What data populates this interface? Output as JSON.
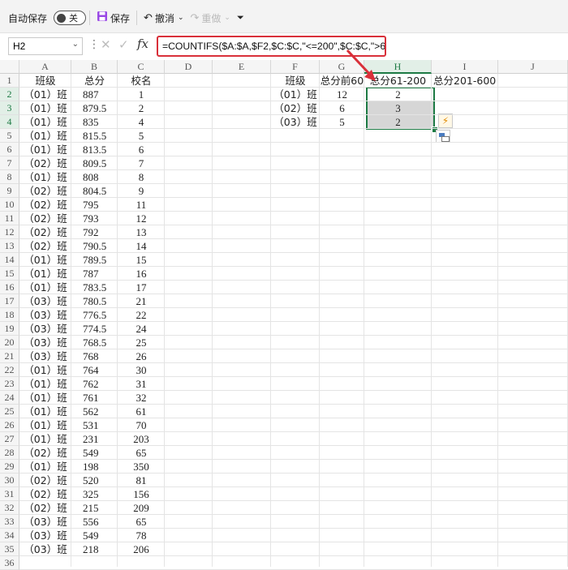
{
  "toolbar": {
    "autosave_label": "自动保存",
    "autosave_state": "关",
    "save_label": "保存",
    "undo_label": "撤消",
    "redo_label": "重做"
  },
  "formula_bar": {
    "name_box": "H2",
    "fx_label": "fx",
    "formula": "=COUNTIFS($A:$A,$F2,$C:$C,\"<=200\",$C:$C,\">60\")"
  },
  "columns": [
    "A",
    "B",
    "C",
    "D",
    "E",
    "F",
    "G",
    "H",
    "I",
    "J"
  ],
  "selected_column": "H",
  "rows": [
    "1",
    "2",
    "3",
    "4",
    "5",
    "6",
    "7",
    "8",
    "9",
    "10",
    "11",
    "12",
    "13",
    "14",
    "15",
    "16",
    "17",
    "18",
    "19",
    "20",
    "21",
    "22",
    "23",
    "24",
    "25",
    "26",
    "27",
    "28",
    "29",
    "30",
    "31",
    "32",
    "33",
    "34",
    "35",
    "36"
  ],
  "data_table": {
    "headers": [
      "班级",
      "总分",
      "校名"
    ],
    "rows": [
      [
        "（01）班",
        "887",
        "1"
      ],
      [
        "（01）班",
        "879.5",
        "2"
      ],
      [
        "（01）班",
        "835",
        "4"
      ],
      [
        "（01）班",
        "815.5",
        "5"
      ],
      [
        "（01）班",
        "813.5",
        "6"
      ],
      [
        "（02）班",
        "809.5",
        "7"
      ],
      [
        "（01）班",
        "808",
        "8"
      ],
      [
        "（02）班",
        "804.5",
        "9"
      ],
      [
        "（02）班",
        "795",
        "11"
      ],
      [
        "（02）班",
        "793",
        "12"
      ],
      [
        "（02）班",
        "792",
        "13"
      ],
      [
        "（02）班",
        "790.5",
        "14"
      ],
      [
        "（01）班",
        "789.5",
        "15"
      ],
      [
        "（01）班",
        "787",
        "16"
      ],
      [
        "（01）班",
        "783.5",
        "17"
      ],
      [
        "（03）班",
        "780.5",
        "21"
      ],
      [
        "（03）班",
        "776.5",
        "22"
      ],
      [
        "（03）班",
        "774.5",
        "24"
      ],
      [
        "（03）班",
        "768.5",
        "25"
      ],
      [
        "（03）班",
        "768",
        "26"
      ],
      [
        "（01）班",
        "764",
        "30"
      ],
      [
        "（01）班",
        "762",
        "31"
      ],
      [
        "（01）班",
        "761",
        "32"
      ],
      [
        "（01）班",
        "562",
        "61"
      ],
      [
        "（01）班",
        "531",
        "70"
      ],
      [
        "（01）班",
        "231",
        "203"
      ],
      [
        "（02）班",
        "549",
        "65"
      ],
      [
        "（01）班",
        "198",
        "350"
      ],
      [
        "（02）班",
        "520",
        "81"
      ],
      [
        "（02）班",
        "325",
        "156"
      ],
      [
        "（02）班",
        "215",
        "209"
      ],
      [
        "（03）班",
        "556",
        "65"
      ],
      [
        "（03）班",
        "549",
        "78"
      ],
      [
        "（03）班",
        "218",
        "206"
      ]
    ]
  },
  "summary_table": {
    "headers": [
      "班级",
      "总分前60",
      "总分61-200",
      "总分201-600"
    ],
    "rows": [
      [
        "（01）班",
        "12",
        "2"
      ],
      [
        "（02）班",
        "6",
        "3"
      ],
      [
        "（03）班",
        "5",
        "2"
      ]
    ]
  },
  "colors": {
    "accent_green": "#1d7a44",
    "highlight_red": "#d9303a",
    "selection_gray": "#d6d6d6"
  },
  "icons": [
    "save-icon",
    "undo-icon",
    "redo-icon",
    "customize-icon",
    "fx-icon",
    "flash-fill-icon",
    "paste-options-icon"
  ]
}
